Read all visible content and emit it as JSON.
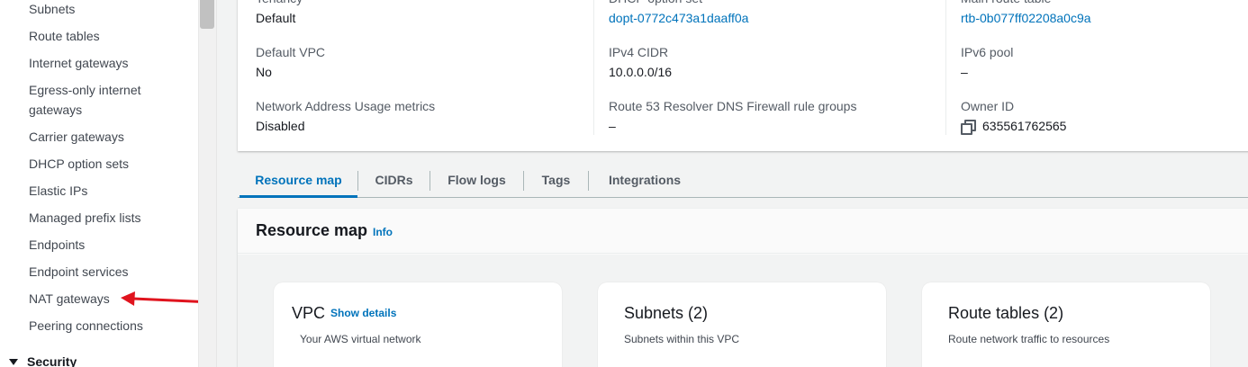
{
  "sidebar": {
    "items": [
      {
        "label": "Subnets"
      },
      {
        "label": "Route tables"
      },
      {
        "label": "Internet gateways"
      },
      {
        "label": "Egress-only internet"
      },
      {
        "label": "gateways"
      },
      {
        "label": "Carrier gateways"
      },
      {
        "label": "DHCP option sets"
      },
      {
        "label": "Elastic IPs"
      },
      {
        "label": "Managed prefix lists"
      },
      {
        "label": "Endpoints"
      },
      {
        "label": "Endpoint services"
      },
      {
        "label": "NAT gateways"
      },
      {
        "label": "Peering connections"
      }
    ],
    "section_label": "Security"
  },
  "details": {
    "col1": [
      {
        "label": "Tenancy",
        "value": "Default"
      },
      {
        "label": "Default VPC",
        "value": "No"
      },
      {
        "label": "Network Address Usage metrics",
        "value": "Disabled"
      }
    ],
    "col2": [
      {
        "label": "DHCP option set",
        "value": "dopt-0772c473a1daaff0a"
      },
      {
        "label": "IPv4 CIDR",
        "value": "10.0.0.0/16"
      },
      {
        "label": "Route 53 Resolver DNS Firewall rule groups",
        "value": "–"
      }
    ],
    "col3": [
      {
        "label": "Main route table",
        "value": "rtb-0b077ff02208a0c9a"
      },
      {
        "label": "IPv6 pool",
        "value": "–"
      },
      {
        "label": "Owner ID",
        "value": "635561762565"
      }
    ]
  },
  "tabs": [
    {
      "label": "Resource map"
    },
    {
      "label": "CIDRs"
    },
    {
      "label": "Flow logs"
    },
    {
      "label": "Tags"
    },
    {
      "label": "Integrations"
    }
  ],
  "resource_map": {
    "title": "Resource map",
    "info": "Info",
    "cards": [
      {
        "title": "VPC",
        "link": "Show details",
        "subtitle": "Your AWS virtual network"
      },
      {
        "title": "Subnets (2)",
        "subtitle": "Subnets within this VPC"
      },
      {
        "title": "Route tables (2)",
        "subtitle": "Route network traffic to resources"
      }
    ]
  },
  "colors": {
    "link": "#0073bb",
    "annotation_arrow": "#e0141e"
  }
}
